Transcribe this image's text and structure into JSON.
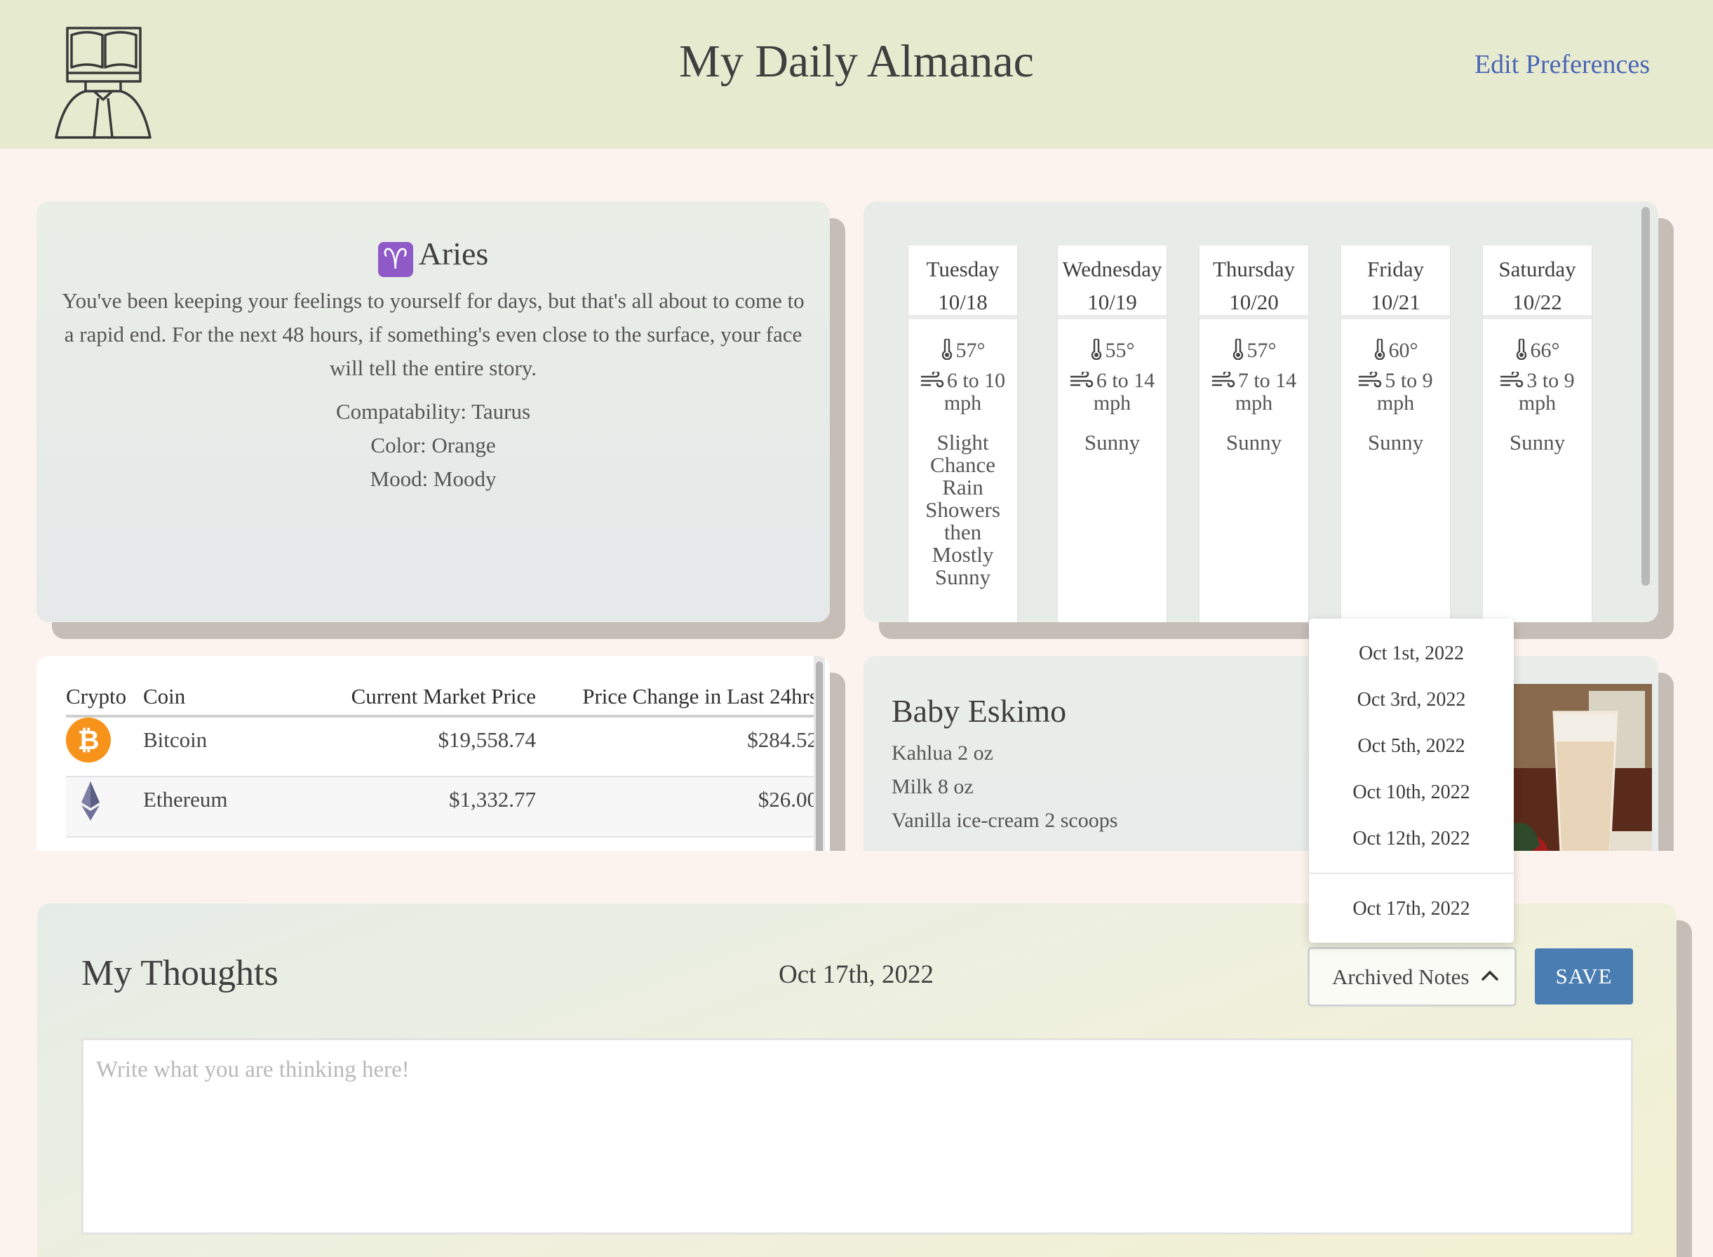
{
  "header": {
    "title": "My Daily Almanac",
    "edit_preferences": "Edit Preferences"
  },
  "horoscope": {
    "sign": "Aries",
    "symbol": "♈",
    "description": "You've been keeping your feelings to yourself for days, but that's all about to come to a rapid end. For the next 48 hours, if something's even close to the surface, your face will tell the entire story.",
    "compatibility": "Compatability: Taurus",
    "color": "Color: Orange",
    "mood": "Mood: Moody"
  },
  "weather": {
    "days": [
      {
        "day": "Tuesday",
        "date": "10/18",
        "temp": "57°",
        "wind": "6 to 10 mph",
        "conditions": "Slight Chance Rain Showers then Mostly Sunny"
      },
      {
        "day": "Wednesday",
        "date": "10/19",
        "temp": "55°",
        "wind": "6 to 14 mph",
        "conditions": "Sunny"
      },
      {
        "day": "Thursday",
        "date": "10/20",
        "temp": "57°",
        "wind": "7 to 14 mph",
        "conditions": "Sunny"
      },
      {
        "day": "Friday",
        "date": "10/21",
        "temp": "60°",
        "wind": "5 to 9 mph",
        "conditions": "Sunny"
      },
      {
        "day": "Saturday",
        "date": "10/22",
        "temp": "66°",
        "wind": "3 to 9 mph",
        "conditions": "Sunny"
      }
    ]
  },
  "crypto": {
    "headers": [
      "Crypto",
      "Coin",
      "Current Market Price",
      "Price Change in Last 24hrs"
    ],
    "rows": [
      {
        "icon": "bitcoin-icon",
        "coin": "Bitcoin",
        "price": "$19,558.74",
        "change": "$284.52"
      },
      {
        "icon": "ethereum-icon",
        "coin": "Ethereum",
        "price": "$1,332.77",
        "change": "$26.00"
      }
    ]
  },
  "recipe": {
    "name": "Baby Eskimo",
    "ingredients": [
      "Kahlua 2 oz",
      "Milk 8 oz",
      "Vanilla ice-cream 2 scoops"
    ],
    "image": "iced-drink-photo"
  },
  "thoughts": {
    "title": "My Thoughts",
    "date": "Oct 17th, 2022",
    "archived_label": "Archived Notes",
    "save_label": "SAVE",
    "placeholder": "Write what you are thinking here!"
  },
  "archived_dropdown": {
    "items": [
      "Oct 1st, 2022",
      "Oct 3rd, 2022",
      "Oct 5th, 2022",
      "Oct 10th, 2022",
      "Oct 12th, 2022",
      "Oct 17th, 2022"
    ]
  },
  "colors": {
    "header_bg": "#e6ebd0",
    "page_bg": "#fdf3ee",
    "link": "#4b65b5",
    "save_button": "#4a7eb3",
    "bitcoin": "#f7931a"
  }
}
